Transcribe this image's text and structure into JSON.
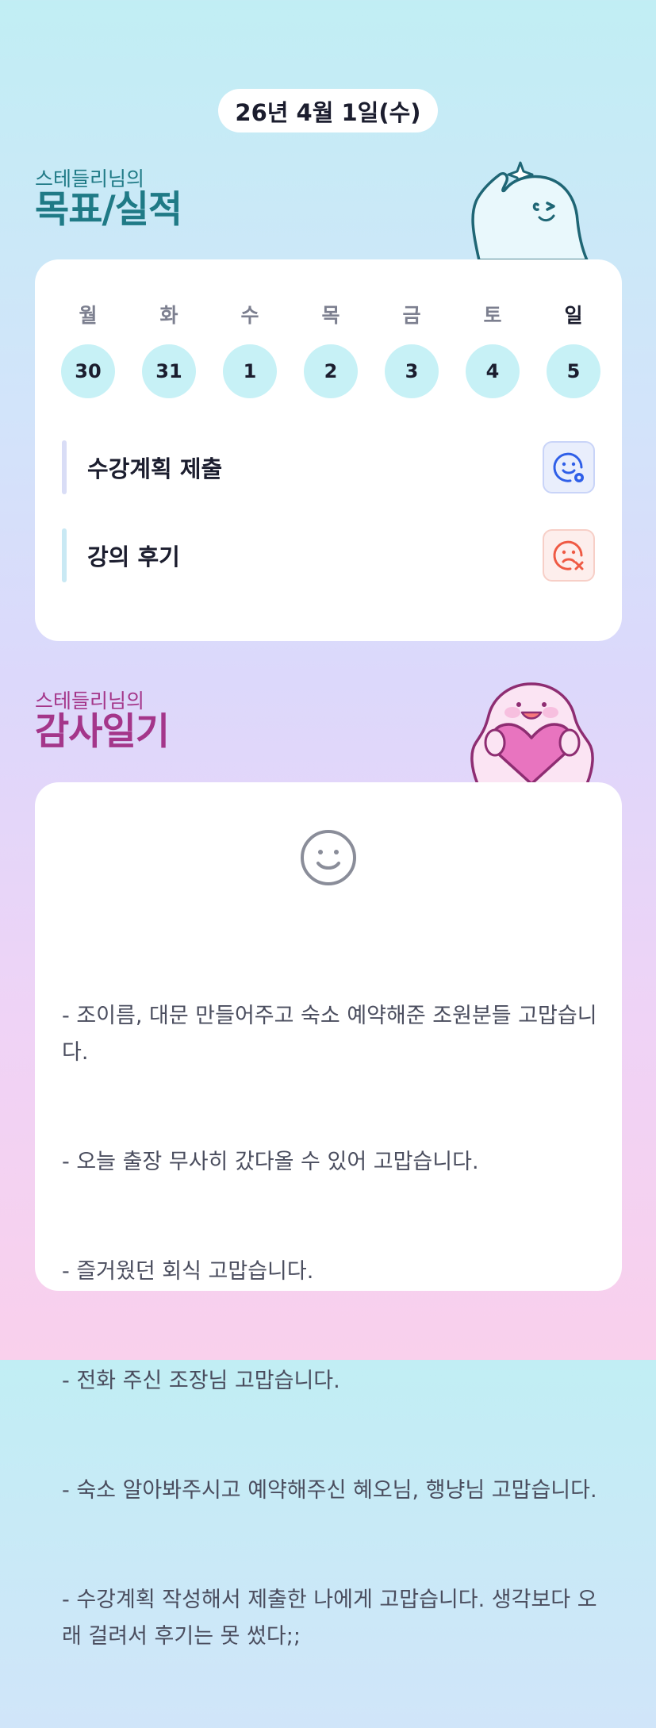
{
  "date": "26년 4월 1일(수)",
  "goals": {
    "heading_sub": "스테들리님의",
    "heading_main": "목표/실적",
    "mascot_icon": "sparkle-ghost-waving",
    "week": [
      {
        "day": "월",
        "date": "30"
      },
      {
        "day": "화",
        "date": "31"
      },
      {
        "day": "수",
        "date": "1"
      },
      {
        "day": "목",
        "date": "2"
      },
      {
        "day": "금",
        "date": "3"
      },
      {
        "day": "토",
        "date": "4"
      },
      {
        "day": "일",
        "date": "5"
      }
    ],
    "tasks": [
      {
        "label": "수강계획 제출",
        "status": "done",
        "icon": "smile-check-icon",
        "color": "#2f5fe8"
      },
      {
        "label": "강의 후기",
        "status": "failed",
        "icon": "sad-x-icon",
        "color": "#ef5a44"
      }
    ]
  },
  "gratitude": {
    "heading_sub": "스테들리님의",
    "heading_main": "감사일기",
    "mascot_icon": "ghost-holding-heart",
    "mood_icon": "smile-face-icon",
    "entries": [
      "- 조이름, 대문 만들어주고 숙소 예약해준 조원분들 고맙습니다.",
      "- 오늘 출장 무사히 갔다올 수 있어 고맙습니다.",
      "- 즐거웠던 회식 고맙습니다.",
      "- 전화 주신 조장님 고맙습니다.",
      "- 숙소 알아봐주시고 예약해주신 혜오님, 행냥님 고맙습니다.",
      "- 수강계획 작성해서 제출한 나에게 고맙습니다. 생각보다 오래 걸려서 후기는 못 썼다;;"
    ]
  },
  "colors": {
    "goal_heading": "#1f7a86",
    "gratitude_heading": "#a4368a",
    "day_circle": "#c7f1f6"
  }
}
